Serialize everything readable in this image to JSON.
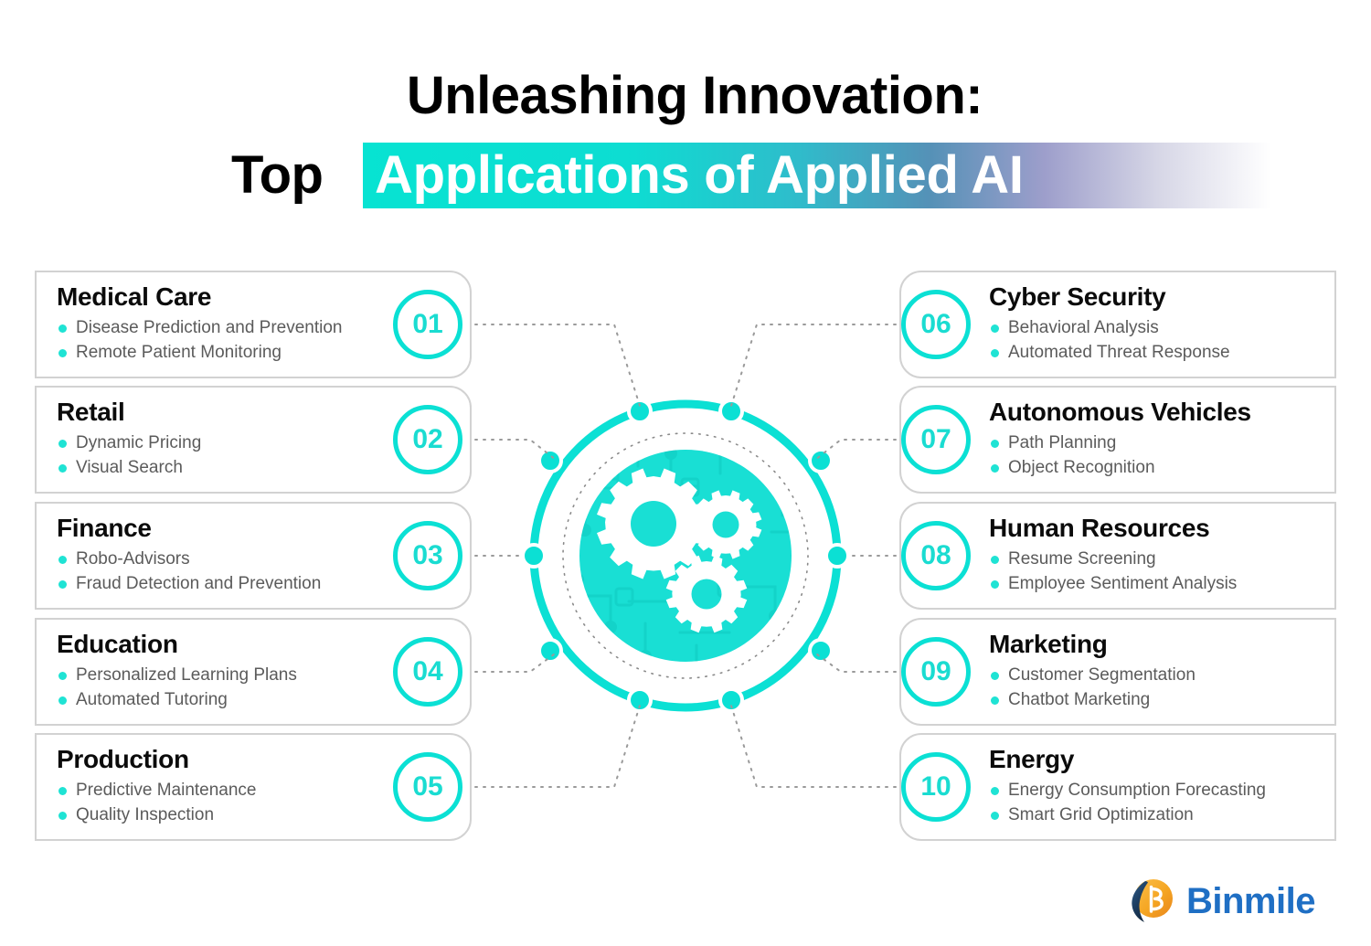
{
  "title": {
    "line1": "Unleashing Innovation:",
    "line2_prefix": "Top",
    "line2_highlight": "Applications of Applied AI"
  },
  "colors": {
    "accent_cyan": "#0BE0D4",
    "bullet_cyan": "#1FE3D4",
    "card_border": "#D2D2D2",
    "heading_black": "#0B0B0B",
    "body_gray": "#5B5B5B",
    "gradient_start": "#07E3D2",
    "gradient_mid": "#5591B7",
    "gradient_end": "#FFFFFF",
    "logo_blue": "#1F6FC4",
    "logo_orange": "#F5A623",
    "logo_navy": "#1B3A5C"
  },
  "center": {
    "icon": "gears-icon",
    "node_count": 10
  },
  "cards_left": [
    {
      "number": "01",
      "title": "Medical Care",
      "bullets": [
        "Disease Prediction and Prevention",
        "Remote Patient Monitoring"
      ]
    },
    {
      "number": "02",
      "title": "Retail",
      "bullets": [
        "Dynamic Pricing",
        "Visual Search"
      ]
    },
    {
      "number": "03",
      "title": "Finance",
      "bullets": [
        "Robo-Advisors",
        "Fraud Detection and Prevention"
      ]
    },
    {
      "number": "04",
      "title": "Education",
      "bullets": [
        "Personalized Learning Plans",
        "Automated Tutoring"
      ]
    },
    {
      "number": "05",
      "title": "Production",
      "bullets": [
        "Predictive Maintenance",
        "Quality Inspection"
      ]
    }
  ],
  "cards_right": [
    {
      "number": "06",
      "title": "Cyber Security",
      "bullets": [
        "Behavioral Analysis",
        "Automated Threat Response"
      ]
    },
    {
      "number": "07",
      "title": "Autonomous Vehicles",
      "bullets": [
        "Path Planning",
        "Object Recognition"
      ]
    },
    {
      "number": "08",
      "title": "Human Resources",
      "bullets": [
        "Resume Screening",
        "Employee Sentiment Analysis"
      ]
    },
    {
      "number": "09",
      "title": "Marketing",
      "bullets": [
        "Customer Segmentation",
        "Chatbot Marketing"
      ]
    },
    {
      "number": "10",
      "title": "Energy",
      "bullets": [
        "Energy Consumption Forecasting",
        "Smart Grid Optimization"
      ]
    }
  ],
  "logo": {
    "wordmark": "Binmile",
    "mark": "binmile-b-logo"
  }
}
